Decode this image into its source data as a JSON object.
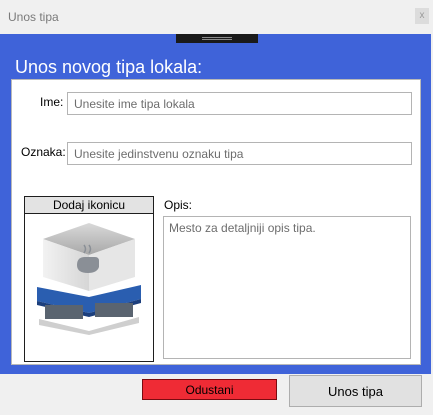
{
  "window": {
    "title": "Unos tipa",
    "close_symbol": "x"
  },
  "heading": "Unos novog tipa lokala:",
  "form": {
    "name_label": "Ime:",
    "name_placeholder": "Unesite ime tipa lokala",
    "code_label": "Oznaka:",
    "code_placeholder": "Unesite jedinstvenu oznaku tipa",
    "icon_button": "Dodaj ikonicu",
    "icon_image": "cafe-shop-icon",
    "description_label": "Opis:",
    "description_placeholder": "Mesto za detaljniji opis tipa."
  },
  "buttons": {
    "cancel": "Odustani",
    "submit": "Unos tipa"
  },
  "colors": {
    "panel": "#3f63d9",
    "cancel": "#ef2b35",
    "awning": "#2a5eb0"
  }
}
